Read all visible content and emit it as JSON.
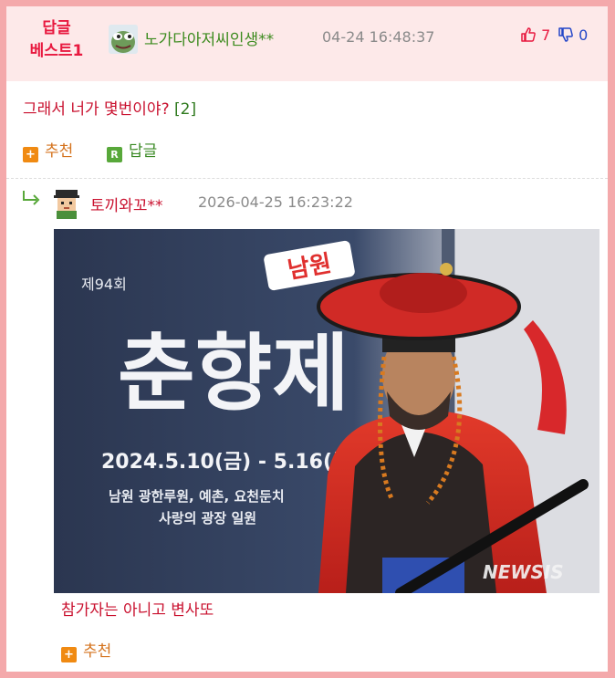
{
  "best_comment": {
    "badge_line1": "답글",
    "badge_line2": "베스트1",
    "nickname": "노가다아저씨인생**",
    "timestamp": "04-24 16:48:37",
    "upvotes": "7",
    "downvotes": "0",
    "text": "그래서 너가 몇번이야?",
    "reply_count": "[2]",
    "recommend_label": "추천",
    "reply_label": "답글"
  },
  "reply_comment": {
    "nickname": "토끼와꼬**",
    "timestamp": "2026-04-25 16:23:22",
    "image": {
      "banner_event": "제94회",
      "banner_place_tag": "남원",
      "banner_title": "춘향제",
      "banner_dates": "2024.5.10(금) - 5.16(목)",
      "banner_venue_line1": "남원 광한루원, 예촌, 요천둔치",
      "banner_venue_line2": "사랑의 광장 일원",
      "watermark": "NEWSIS"
    },
    "text": "참가자는 아니고 변사또",
    "recommend_label": "추천"
  },
  "colors": {
    "frame_border": "#f4a9ab",
    "best_header_bg": "#fde9e9",
    "accent_red": "#e8193f",
    "nick_green": "#3d8b1f",
    "down_blue": "#2346c8",
    "recommend_orange": "#d4721c"
  },
  "icons": [
    "thumbs-up-icon",
    "thumbs-down-icon",
    "plus-icon",
    "reply-r-icon",
    "reply-arrow-icon"
  ]
}
